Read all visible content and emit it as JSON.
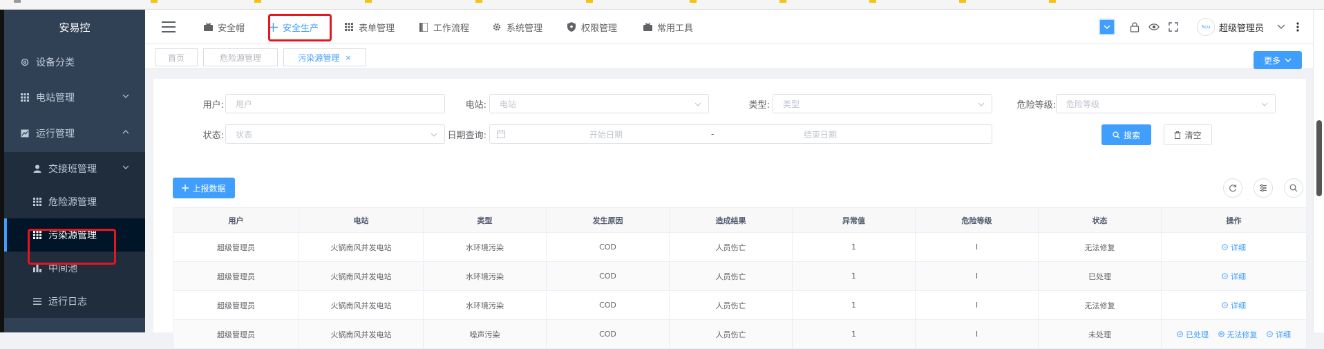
{
  "sidebar": {
    "brand": "安易控",
    "items": [
      {
        "label": "设备分类",
        "icon": "gear-icon"
      },
      {
        "label": "电站管理",
        "icon": "grid-icon"
      },
      {
        "label": "运行管理",
        "icon": "chart-icon"
      },
      {
        "label": "交接班管理",
        "icon": "user-icon"
      },
      {
        "label": "危险源管理",
        "icon": "grid-icon"
      },
      {
        "label": "污染源管理",
        "icon": "grid-icon"
      },
      {
        "label": "中间池",
        "icon": "bar-chart-icon"
      },
      {
        "label": "运行日志",
        "icon": "list-icon"
      }
    ]
  },
  "topnav": {
    "items": [
      {
        "label": "安全帽",
        "icon": "briefcase-icon"
      },
      {
        "label": "安全生产",
        "icon": "plus-icon"
      },
      {
        "label": "表单管理",
        "icon": "grid-icon"
      },
      {
        "label": "工作流程",
        "icon": "book-icon"
      },
      {
        "label": "系统管理",
        "icon": "gear-icon"
      },
      {
        "label": "权限管理",
        "icon": "shield-icon"
      },
      {
        "label": "常用工具",
        "icon": "briefcase-icon"
      }
    ],
    "username": "超级管理员",
    "avatar_text": "Scu"
  },
  "tags": {
    "items": [
      "首页",
      "危险源管理",
      "污染源管理"
    ],
    "close": "×",
    "more": "更多"
  },
  "filters": {
    "user_label": "用户:",
    "user_placeholder": "用户",
    "station_label": "电站:",
    "station_placeholder": "电站",
    "type_label": "类型:",
    "type_placeholder": "类型",
    "risk_label": "危险等级:",
    "risk_placeholder": "危险等级",
    "status_label": "状态:",
    "status_placeholder": "状态",
    "date_label": "日期查询:",
    "date_start": "开始日期",
    "date_sep": "-",
    "date_end": "结束日期",
    "search": "搜索",
    "clear": "清空"
  },
  "toolbar": {
    "report": "上报数据"
  },
  "table": {
    "headers": [
      "用户",
      "电站",
      "类型",
      "发生原因",
      "造成结果",
      "异常值",
      "危险等级",
      "状态",
      "操作"
    ],
    "rows": [
      {
        "cells": [
          "超级管理员",
          "火锅南风并发电站",
          "水环境污染",
          "COD",
          "人员伤亡",
          "1",
          "I",
          "无法修复"
        ],
        "actions": [
          "详细"
        ]
      },
      {
        "cells": [
          "超级管理员",
          "火锅南风并发电站",
          "水环境污染",
          "COD",
          "人员伤亡",
          "1",
          "I",
          "已处理"
        ],
        "actions": [
          "详细"
        ]
      },
      {
        "cells": [
          "超级管理员",
          "火锅南风并发电站",
          "水环境污染",
          "COD",
          "人员伤亡",
          "1",
          "I",
          "无法修复"
        ],
        "actions": [
          "详细"
        ]
      },
      {
        "cells": [
          "超级管理员",
          "火锅南风并发电站",
          "噪声污染",
          "COD",
          "人员伤亡",
          "1",
          "I",
          "未处理"
        ],
        "actions": [
          "已处理",
          "无法修复",
          "详细"
        ]
      }
    ]
  },
  "colors": {
    "sidebar_bg": "#304156",
    "accent": "#409eff",
    "highlight_box": "#e5161f"
  }
}
